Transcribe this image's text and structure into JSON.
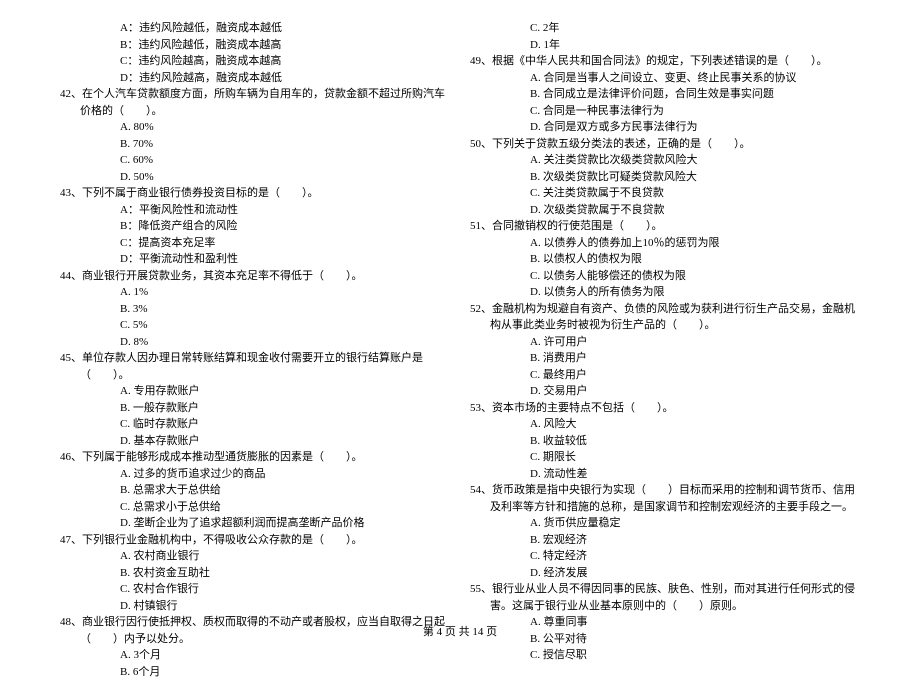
{
  "left": {
    "q41_opts": {
      "A": "A：违约风险越低，融资成本越低",
      "B": "B：违约风险越低，融资成本越高",
      "C": "C：违约风险越高，融资成本越高",
      "D": "D：违约风险越高，融资成本越低"
    },
    "q42": {
      "text": "42、在个人汽车贷款额度方面，所购车辆为自用车的，贷款金额不超过所购汽车价格的（　　）。",
      "opts": {
        "A": "A. 80%",
        "B": "B. 70%",
        "C": "C. 60%",
        "D": "D. 50%"
      }
    },
    "q43": {
      "text": "43、下列不属于商业银行债券投资目标的是（　　）。",
      "opts": {
        "A": "A：平衡风险性和流动性",
        "B": "B：降低资产组合的风险",
        "C": "C：提高资本充足率",
        "D": "D：平衡流动性和盈利性"
      }
    },
    "q44": {
      "text": "44、商业银行开展贷款业务，其资本充足率不得低于（　　）。",
      "opts": {
        "A": "A. 1%",
        "B": "B. 3%",
        "C": "C. 5%",
        "D": "D. 8%"
      }
    },
    "q45": {
      "text": "45、单位存款人因办理日常转账结算和现金收付需要开立的银行结算账户是（　　）。",
      "opts": {
        "A": "A. 专用存款账户",
        "B": "B. 一般存款账户",
        "C": "C. 临时存款账户",
        "D": "D. 基本存款账户"
      }
    },
    "q46": {
      "text": "46、下列属于能够形成成本推动型通货膨胀的因素是（　　）。",
      "opts": {
        "A": "A. 过多的货币追求过少的商品",
        "B": "B. 总需求大于总供给",
        "C": "C. 总需求小于总供给",
        "D": "D. 垄断企业为了追求超额利润而提高垄断产品价格"
      }
    },
    "q47": {
      "text": "47、下列银行业金融机构中，不得吸收公众存款的是（　　）。",
      "opts": {
        "A": "A. 农村商业银行",
        "B": "B. 农村资金互助社",
        "C": "C. 农村合作银行",
        "D": "D. 村镇银行"
      }
    },
    "q48": {
      "text": "48、商业银行因行使抵押权、质权而取得的不动产或者股权，应当自取得之日起（　　）内予以处分。",
      "opts": {
        "A": "A. 3个月",
        "B": "B. 6个月"
      }
    }
  },
  "right": {
    "q48_opts": {
      "C": "C. 2年",
      "D": "D. 1年"
    },
    "q49": {
      "text": "49、根据《中华人民共和国合同法》的规定，下列表述错误的是（　　）。",
      "opts": {
        "A": "A. 合同是当事人之间设立、变更、终止民事关系的协议",
        "B": "B. 合同成立是法律评价问题，合同生效是事实问题",
        "C": "C. 合同是一种民事法律行为",
        "D": "D. 合同是双方或多方民事法律行为"
      }
    },
    "q50": {
      "text": "50、下列关于贷款五级分类法的表述，正确的是（　　）。",
      "opts": {
        "A": "A. 关注类贷款比次级类贷款风险大",
        "B": "B. 次级类贷款比可疑类贷款风险大",
        "C": "C. 关注类贷款属于不良贷款",
        "D": "D. 次级类贷款属于不良贷款"
      }
    },
    "q51": {
      "text": "51、合同撤销权的行使范围是（　　）。",
      "opts": {
        "A": "A. 以债券人的债券加上10％的惩罚为限",
        "B": "B. 以债权人的债权为限",
        "C": "C. 以债务人能够偿还的债权为限",
        "D": "D. 以债务人的所有债务为限"
      }
    },
    "q52": {
      "text": "52、金融机构为规避自有资产、负债的风险或为获利进行衍生产品交易，金融机构从事此类业务时被视为衍生产品的（　　）。",
      "opts": {
        "A": "A. 许可用户",
        "B": "B. 消费用户",
        "C": "C. 最终用户",
        "D": "D. 交易用户"
      }
    },
    "q53": {
      "text": "53、资本市场的主要特点不包括（　　）。",
      "opts": {
        "A": "A. 风险大",
        "B": "B. 收益较低",
        "C": "C. 期限长",
        "D": "D. 流动性差"
      }
    },
    "q54": {
      "text": "54、货币政策是指中央银行为实现（　　）目标而采用的控制和调节货币、信用及利率等方针和措施的总称，是国家调节和控制宏观经济的主要手段之一。",
      "opts": {
        "A": "A. 货币供应量稳定",
        "B": "B. 宏观经济",
        "C": "C. 特定经济",
        "D": "D. 经济发展"
      }
    },
    "q55": {
      "text": "55、银行业从业人员不得因同事的民族、肤色、性别，而对其进行任何形式的侵害。这属于银行业从业基本原则中的（　　）原则。",
      "opts": {
        "A": "A. 尊重同事",
        "B": "B. 公平对待",
        "C": "C. 授信尽职"
      }
    }
  },
  "footer": "第 4 页 共 14 页"
}
